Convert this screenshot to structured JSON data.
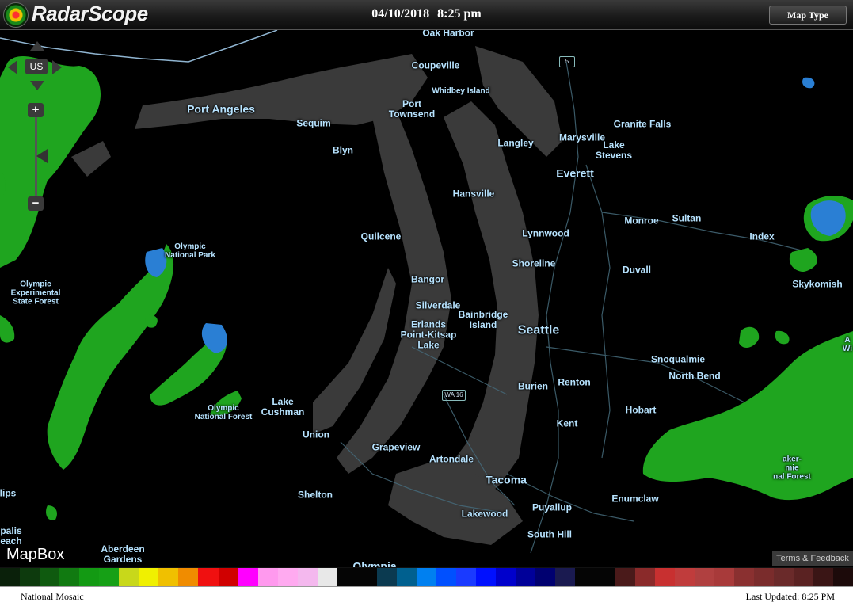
{
  "header": {
    "app_name": "RadarScope",
    "date": "04/10/2018",
    "time": "8:25 pm",
    "map_type_label": "Map Type"
  },
  "map_controls": {
    "region_label": "US",
    "zoom_in": "+",
    "zoom_out": "−"
  },
  "map_labels": [
    {
      "text": "Oak Harbor",
      "size": "md"
    },
    {
      "text": "Coupeville",
      "size": "md"
    },
    {
      "text": "Whidbey Island",
      "size": "sm"
    },
    {
      "text": "Port Angeles",
      "size": "lg"
    },
    {
      "text": "Sequim",
      "size": "md"
    },
    {
      "text": "Port\nTownsend",
      "size": "md"
    },
    {
      "text": "Blyn",
      "size": "md"
    },
    {
      "text": "Granite Falls",
      "size": "md"
    },
    {
      "text": "Marysville",
      "size": "md"
    },
    {
      "text": "Lake\nStevens",
      "size": "md"
    },
    {
      "text": "Langley",
      "size": "md"
    },
    {
      "text": "Everett",
      "size": "lg"
    },
    {
      "text": "Hansville",
      "size": "md"
    },
    {
      "text": "Monroe",
      "size": "md"
    },
    {
      "text": "Sultan",
      "size": "md"
    },
    {
      "text": "Index",
      "size": "md"
    },
    {
      "text": "Lynnwood",
      "size": "md"
    },
    {
      "text": "Quilcene",
      "size": "md"
    },
    {
      "text": "Olympic\nNational Park",
      "size": "sm"
    },
    {
      "text": "Shoreline",
      "size": "md"
    },
    {
      "text": "Duvall",
      "size": "md"
    },
    {
      "text": "Bangor",
      "size": "md"
    },
    {
      "text": "Skykomish",
      "size": "md"
    },
    {
      "text": "Olympic\nExperimental\nState Forest",
      "size": "sm"
    },
    {
      "text": "Silverdale",
      "size": "md"
    },
    {
      "text": "Bainbridge\nIsland",
      "size": "md"
    },
    {
      "text": "Erlands\nPoint-Kitsap\nLake",
      "size": "md"
    },
    {
      "text": "Seattle",
      "size": "xl"
    },
    {
      "text": "Snoqualmie",
      "size": "md"
    },
    {
      "text": "North Bend",
      "size": "md"
    },
    {
      "text": "Burien",
      "size": "md"
    },
    {
      "text": "Renton",
      "size": "md"
    },
    {
      "text": "Lake\nCushman",
      "size": "md"
    },
    {
      "text": "Olympic\nNational Forest",
      "size": "sm"
    },
    {
      "text": "Hobart",
      "size": "md"
    },
    {
      "text": "Kent",
      "size": "md"
    },
    {
      "text": "Union",
      "size": "md"
    },
    {
      "text": "Grapeview",
      "size": "md"
    },
    {
      "text": "Artondale",
      "size": "md"
    },
    {
      "text": "Tacoma",
      "size": "lg"
    },
    {
      "text": "Shelton",
      "size": "md"
    },
    {
      "text": "Enumclaw",
      "size": "md"
    },
    {
      "text": "lips",
      "size": "md"
    },
    {
      "text": "Puyallup",
      "size": "md"
    },
    {
      "text": "Lakewood",
      "size": "md"
    },
    {
      "text": "palis\neach",
      "size": "md"
    },
    {
      "text": "South Hill",
      "size": "md"
    },
    {
      "text": "Aberdeen\nGardens",
      "size": "md"
    },
    {
      "text": "Olympia",
      "size": "lg"
    },
    {
      "text": "aker-\nmie\nnal Forest",
      "size": "sm"
    },
    {
      "text": "A\nWi",
      "size": "sm"
    }
  ],
  "road_shields": {
    "i5": "5",
    "wa16": "WA 16"
  },
  "attribution": {
    "mapbox": "MapBox",
    "terms": "Terms & Feedback"
  },
  "colorbar": [
    "#0a200a",
    "#0d3a0d",
    "#0f5a0f",
    "#117a11",
    "#139a13",
    "#16a016",
    "#c8d81a",
    "#f0f000",
    "#f0c000",
    "#f08c00",
    "#f01010",
    "#d00000",
    "#ff00ff",
    "#ff99ee",
    "#ffaaf0",
    "#f4b8ee",
    "#e8e8e8",
    "#050505",
    "#050505",
    "#0b3a50",
    "#00608f",
    "#0080f0",
    "#0050ff",
    "#1a3aff",
    "#0010ff",
    "#0000cc",
    "#000099",
    "#000070",
    "#1a1a50",
    "#050505",
    "#050505",
    "#4a1a1a",
    "#8a2a2a",
    "#c83030",
    "#c03c3c",
    "#b04040",
    "#a83a3a",
    "#8a3030",
    "#7a2c2c",
    "#6a2a2a",
    "#5a2222",
    "#3a1515",
    "#1c0a0a"
  ],
  "footer": {
    "source": "National Mosaic",
    "last_updated": "Last Updated: 8:25 PM"
  },
  "colors": {
    "map_land": "#000000",
    "water": "#3a3a3a",
    "radar_green": "#1fa51f",
    "radar_blue": "#2a7fd4",
    "label_color": "#b7e3ff"
  }
}
